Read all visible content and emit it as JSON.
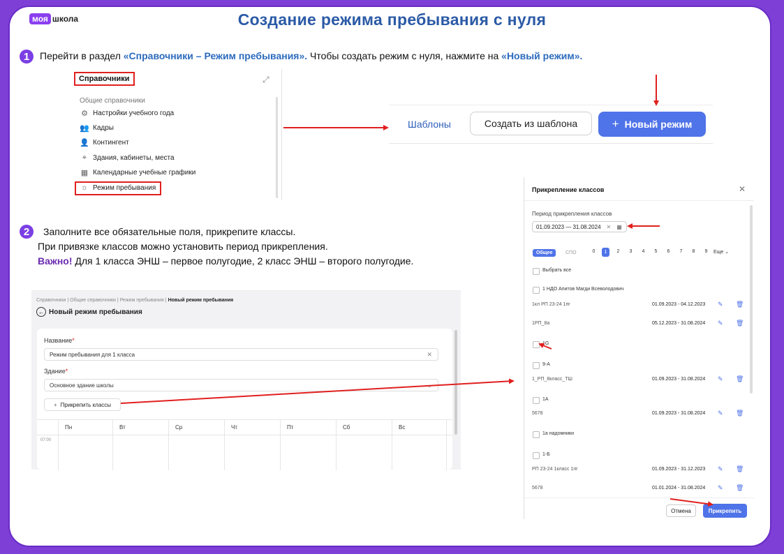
{
  "logo": {
    "moya": "моя",
    "shkola": "школа"
  },
  "title": "Создание режима пребывания с нуля",
  "step1": {
    "num": "1",
    "text_before": "Перейти в раздел ",
    "link1": "«Справочники – Режим пребывания».",
    "text_middle": " Чтобы создать режим с нуля, нажмите на ",
    "link2": "«Новый режим»."
  },
  "step2": {
    "num": "2",
    "line1": "Заполните все обязательные поля, прикрепите классы.",
    "line2": "При привязке классов можно установить период прикрепления.",
    "warn": "Важно!",
    "line3": " Для 1 класса ЭНШ – первое полугодие, 2 класс ЭНШ – второго полугодие."
  },
  "references": {
    "title": "Справочники",
    "expand_icon": "expand-icon",
    "section": "Общие справочники",
    "items": [
      {
        "label": "Настройки учебного года",
        "icon": "gear-icon"
      },
      {
        "label": "Кадры",
        "icon": "people-icon"
      },
      {
        "label": "Контингент",
        "icon": "person-icon"
      },
      {
        "label": "Здания, кабинеты, места",
        "icon": "location-icon"
      },
      {
        "label": "Календарные учебные графики",
        "icon": "calendar-icon"
      },
      {
        "label": "Режим пребывания",
        "icon": "sun-icon"
      }
    ]
  },
  "toolbar": {
    "templates_tab": "Шаблоны",
    "create_from_template": "Создать из шаблона",
    "new_mode": "Новый режим"
  },
  "form": {
    "breadcrumbs": [
      "Справочники",
      "Общие справочники",
      "Режим пребывания"
    ],
    "breadcrumb_current": "Новый режим пребывания",
    "page_title": "Новый режим пребывания",
    "name_label": "Название",
    "name_value": "Режим пребывания для 1 класса",
    "building_label": "Здание",
    "building_value": "Основное здание школы",
    "attach_button": "Прикрепить классы",
    "days": [
      "Пн",
      "Вт",
      "Ср",
      "Чт",
      "Пт",
      "Сб",
      "Вс"
    ],
    "time": "07:00"
  },
  "modal": {
    "title": "Прикрепление классов",
    "period_label": "Период прикрепления классов",
    "period_value": "01.09.2023 — 31.08.2024",
    "seg_general": "Общее",
    "seg_spo": "СПО",
    "grades": [
      "0",
      "1",
      "2",
      "3",
      "4",
      "5",
      "6",
      "7",
      "8",
      "9"
    ],
    "selected_grade": "1",
    "more": "Еще",
    "select_all": "Выбрать все",
    "classes": [
      {
        "name": "1 НДО Апитов Магди Всеволодович"
      },
      {
        "sub": "1кл РП 23-24 1пг",
        "dates": "01.09.2023 - 04.12.2023"
      },
      {
        "sub": "1РП_8а",
        "dates": "05.12.2023 - 31.08.2024"
      },
      {
        "name": "1G"
      },
      {
        "name": "9-А"
      },
      {
        "sub": "1_РП_8класс_ТШ",
        "dates": "01.09.2023 - 31.08.2024"
      },
      {
        "name": "1А"
      },
      {
        "sub": "5678",
        "dates": "01.09.2023 - 31.08.2024"
      },
      {
        "name": "1а надомники"
      },
      {
        "name": "1-Б"
      },
      {
        "sub": "РП 23-24 1класс 1пг",
        "dates": "01.09.2023 - 31.12.2023"
      },
      {
        "sub": "5678",
        "dates": "01.01.2024 - 31.08.2024"
      }
    ],
    "cancel": "Отмена",
    "attach": "Прикрепить"
  },
  "colors": {
    "accent": "#4f73e8",
    "frame": "#7d3fd6",
    "highlight": "#e0201f",
    "title": "#2b5aa6"
  }
}
